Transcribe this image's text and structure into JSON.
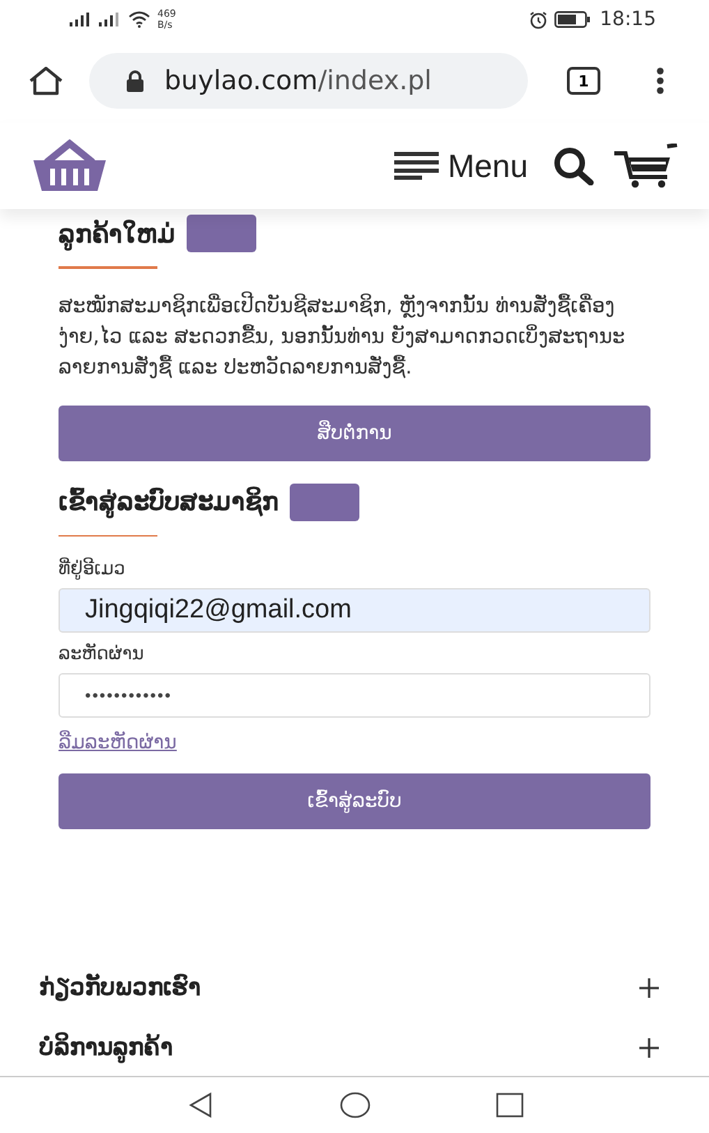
{
  "status_bar": {
    "speed_value": "469",
    "speed_unit": "B/s",
    "time": "18:15"
  },
  "browser": {
    "url_domain": "buylao.com",
    "url_path": "/index.pl",
    "tab_count": "1"
  },
  "header": {
    "menu_label": "Menu"
  },
  "new_customer": {
    "title": "ລູກຄ້າໃຫມ່",
    "text": "ສະໝັກສະມາຊິກເພື່ອເປີດບັນຊີສະມາຊິກ, ຫຼັງຈາກນັ້ນ ທ່ານສັ່ງຊື້ເຄື່ອງງ່າຍ,ໄວ ແລະ ສະດວກຂື້ນ, ນອກນັ້ນທ່ານ ຍັງສາມາດກວດເບິ່ງສະຖານະລາຍການສັ່ງຊື້ ແລະ ປະຫວັດລາຍການສັ່ງຊື້.",
    "button": "ສືບຕໍ່ການ"
  },
  "login": {
    "title": "ເຂົ້າສູ່ລະບົບສະມາຊິກ",
    "email_label": "ທີ່ຢູ່ອີເມວ",
    "email_value": "Jingqiqi22@gmail.com",
    "password_label": "ລະຫັດຜ່ານ",
    "password_value": "••••••••••••",
    "forgot_link": "ລືມລະຫັດຜ່ານ",
    "button": "ເຂົ້າສູ່ລະບົບ"
  },
  "footer_sections": [
    {
      "label": "ກ່ຽວກັບພວກເຮົາ",
      "expanded": false
    },
    {
      "label": "ບໍລິການລູກຄ້າ",
      "expanded": false
    }
  ]
}
